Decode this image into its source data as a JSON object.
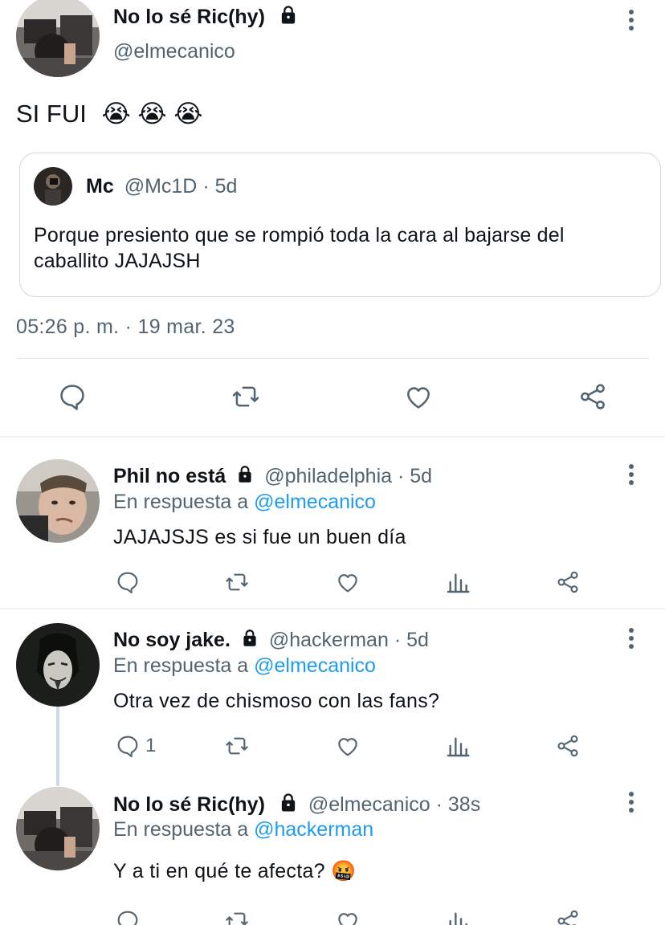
{
  "main_tweet": {
    "author_name": "No lo sé Ric(hy)",
    "handle": "@elmecanico",
    "text": "SI FUI",
    "emojis": [
      "😭",
      "😭",
      "😭"
    ],
    "timestamp": "05:26 p. m. · 19 mar. 23",
    "quoted": {
      "author_name": "Mc",
      "handle": "@Mc1D",
      "time": "· 5d",
      "text_line1": "Porque presiento que se rompió toda la cara al bajarse del",
      "text_line2": "caballito JAJAJSH"
    }
  },
  "replies": [
    {
      "author_name": "Phil no está",
      "handle": "@philadelphia",
      "time": "· 5d",
      "in_reply_prefix": "En respuesta a",
      "in_reply_to": "@elmecanico",
      "text": "JAJAJSJS es si fue un buen día",
      "reply_count": ""
    },
    {
      "author_name": "No soy jake.",
      "handle": "@hackerman",
      "time": "· 5d",
      "in_reply_prefix": "En respuesta a",
      "in_reply_to": "@elmecanico",
      "text": "Otra vez de chismoso con las fans?",
      "reply_count": "1"
    },
    {
      "author_name": "No lo sé Ric(hy)",
      "handle": "@elmecanico",
      "time": "· 38s",
      "in_reply_prefix": "En respuesta a",
      "in_reply_to": "@hackerman",
      "text": "Y a ti en qué te afecta?",
      "emoji": "🤬",
      "reply_count": ""
    }
  ],
  "icons": {
    "reply": "reply-icon",
    "retweet": "retweet-icon",
    "like": "like-icon",
    "analytics": "analytics-icon",
    "share": "share-icon",
    "lock": "lock-icon",
    "more": "more-icon"
  },
  "colors": {
    "link": "#1d9bf0",
    "muted": "#536471",
    "text": "#0f1419",
    "border": "#cfd9de"
  }
}
